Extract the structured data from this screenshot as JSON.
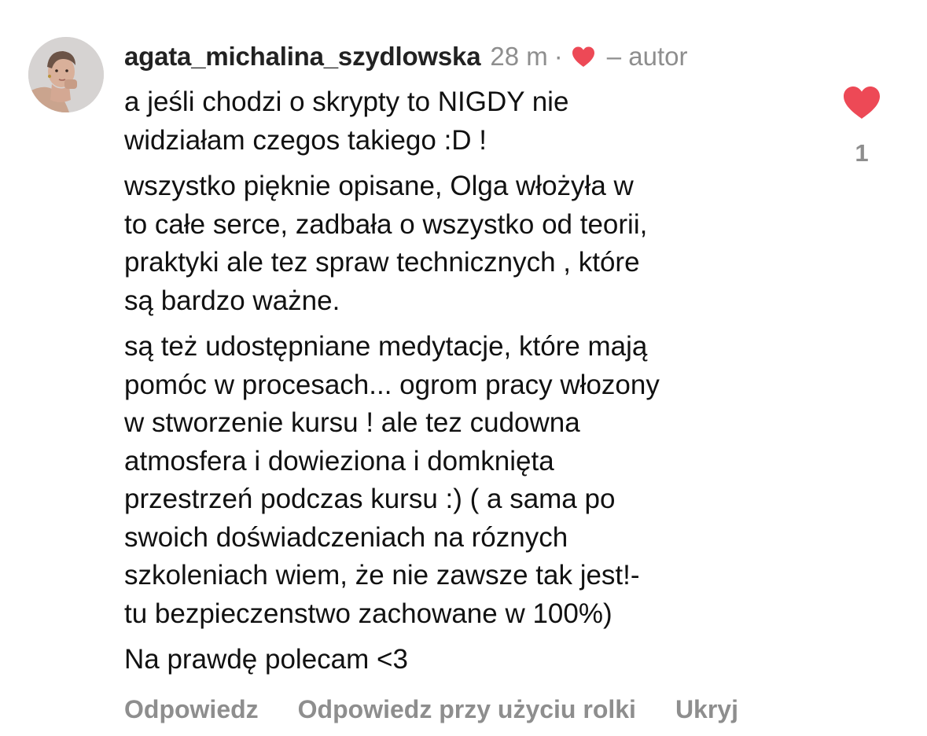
{
  "comment": {
    "username": "agata_michalina_szydlowska",
    "time": "28 m",
    "separator": "·",
    "author_label": "– autor",
    "paragraphs": [
      [
        "a jeśli chodzi o skrypty to NIGDY nie",
        "widziałam czegos takiego :D !"
      ],
      [
        "wszystko pięknie opisane, Olga włożyła w",
        "to całe serce, zadbała o wszystko od teorii,",
        "praktyki ale tez spraw technicznych , które",
        "są bardzo ważne."
      ],
      [
        "są też udostępniane medytacje, które mają",
        "pomóc w procesach... ogrom pracy włozony",
        "w stworzenie kursu ! ale tez cudowna",
        "atmosfera i dowieziona i domknięta",
        "przestrzeń podczas kursu :) ( a sama po",
        "swoich doświadczeniach na róznych",
        "szkoleniach wiem, że nie zawsze tak jest!-",
        "tu bezpieczenstwo zachowane w 100%)"
      ],
      [
        "Na prawdę polecam <3"
      ]
    ],
    "actions": {
      "reply": "Odpowiedz",
      "reply_with_reel": "Odpowiedz przy użyciu rolki",
      "hide": "Ukryj"
    },
    "likes": {
      "count": "1",
      "icon": "heart-filled-icon",
      "liked": true
    },
    "author_heart_icon": "heart-filled-icon"
  },
  "colors": {
    "heart": "#ed4956",
    "muted": "#8e8e8e",
    "text": "#111111",
    "background": "#ffffff"
  }
}
